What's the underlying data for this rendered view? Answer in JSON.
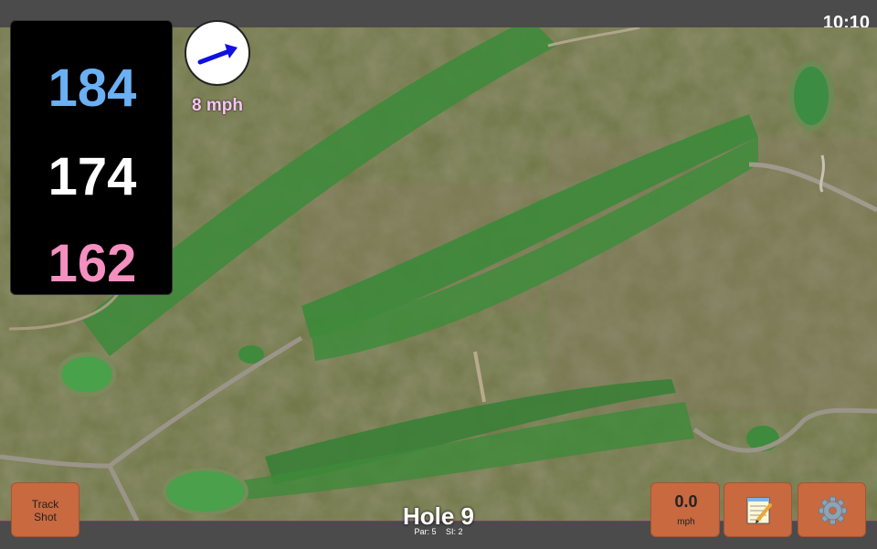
{
  "status_bar": {
    "time": "10:10"
  },
  "distances": {
    "back": "184",
    "middle": "174",
    "front": "162"
  },
  "wind": {
    "speed_label": "8 mph",
    "arrow_color": "#1010e0"
  },
  "hole": {
    "title": "Hole 9",
    "par_label": "Par: 5",
    "si_label": "SI: 2"
  },
  "buttons": {
    "track_shot_line1": "Track",
    "track_shot_line2": "Shot",
    "speed_value": "0.0",
    "speed_unit": "mph",
    "notes_icon": "notepad-icon",
    "settings_icon": "gear-icon"
  },
  "colors": {
    "back_distance": "#6ab0f3",
    "middle_distance": "#ffffff",
    "front_distance": "#f48fc0",
    "button": "#c8693f",
    "accent_border": "#7a3b7a"
  }
}
